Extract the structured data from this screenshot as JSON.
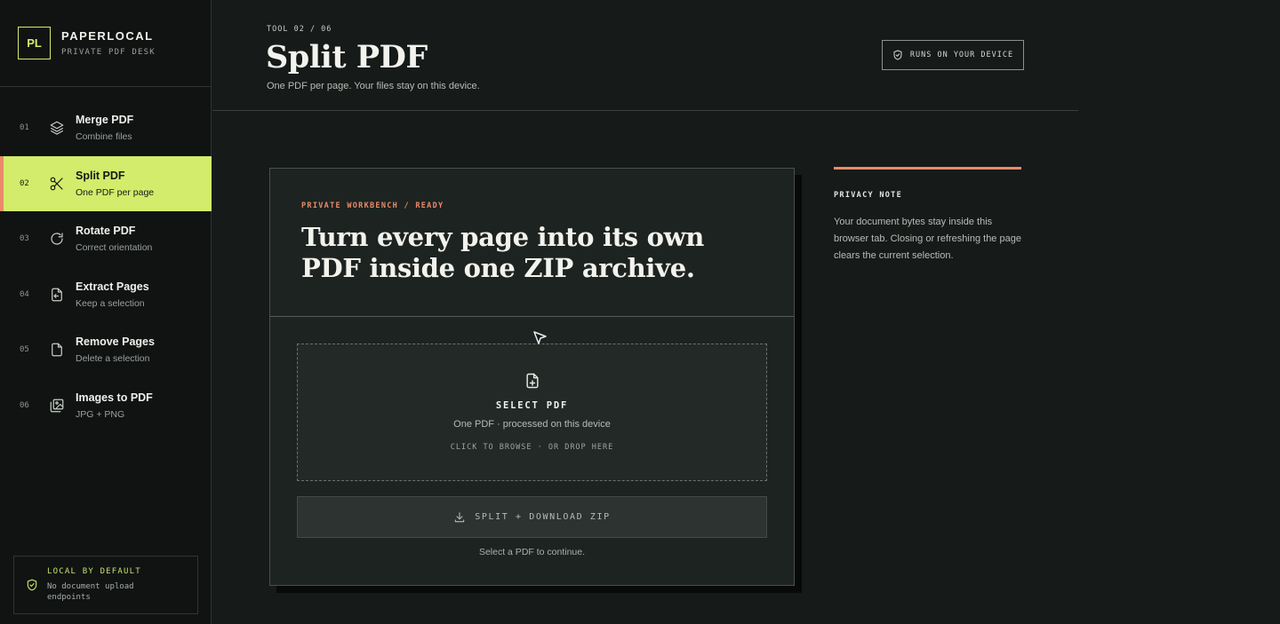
{
  "brand": {
    "logo": "PL",
    "name": "PAPERLOCAL",
    "subtitle": "PRIVATE PDF DESK"
  },
  "nav": {
    "items": [
      {
        "num": "01",
        "title": "Merge PDF",
        "sub": "Combine files",
        "icon": "layers-icon",
        "active": false
      },
      {
        "num": "02",
        "title": "Split PDF",
        "sub": "One PDF per page",
        "icon": "scissors-icon",
        "active": true
      },
      {
        "num": "03",
        "title": "Rotate PDF",
        "sub": "Correct orientation",
        "icon": "rotate-icon",
        "active": false
      },
      {
        "num": "04",
        "title": "Extract Pages",
        "sub": "Keep a selection",
        "icon": "file-extract-icon",
        "active": false
      },
      {
        "num": "05",
        "title": "Remove Pages",
        "sub": "Delete a selection",
        "icon": "file-icon",
        "active": false
      },
      {
        "num": "06",
        "title": "Images to PDF",
        "sub": "JPG + PNG",
        "icon": "images-icon",
        "active": false
      }
    ]
  },
  "local_box": {
    "title": "LOCAL BY DEFAULT",
    "text": "No document upload endpoints",
    "icon": "shield-check-icon"
  },
  "header": {
    "tool_label": "TOOL 02 / 06",
    "title": "Split PDF",
    "subtitle": "One PDF per page. Your files stay on this device.",
    "runs_label": "RUNS ON YOUR DEVICE"
  },
  "workbench": {
    "eyebrow": "PRIVATE WORKBENCH / READY",
    "headline": "Turn every page into its own PDF inside one ZIP archive.",
    "dropzone": {
      "title": "SELECT PDF",
      "subtitle": "One PDF · processed on this device",
      "hint": "CLICK TO BROWSE · OR DROP HERE"
    },
    "split_button": "SPLIT + DOWNLOAD ZIP",
    "split_hint": "Select a PDF to continue."
  },
  "privacy": {
    "title": "PRIVACY NOTE",
    "body": "Your document bytes stay inside this browser tab. Closing or refreshing the page clears the current selection."
  },
  "colors": {
    "accent": "#d3ec6b",
    "coral": "#e98a6a",
    "background": "#161a18",
    "sidebar": "#101312"
  }
}
